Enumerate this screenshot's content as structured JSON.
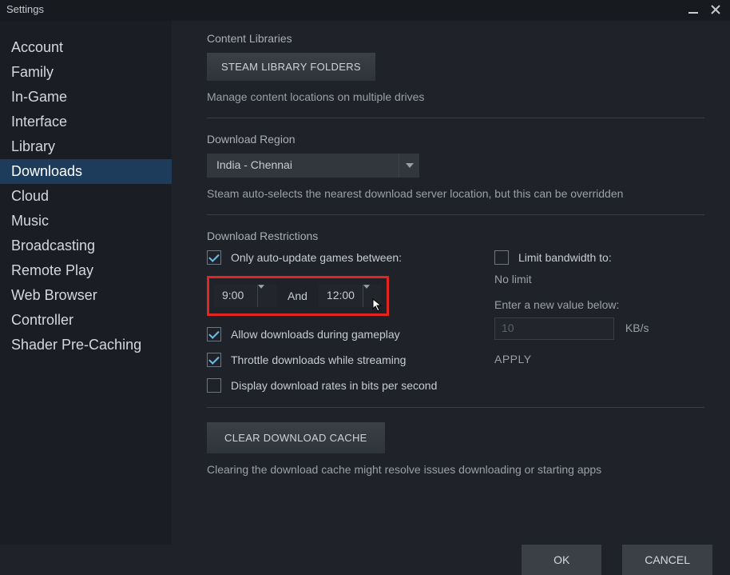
{
  "window": {
    "title": "Settings"
  },
  "sidebar": {
    "items": [
      {
        "label": "Account"
      },
      {
        "label": "Family"
      },
      {
        "label": "In-Game"
      },
      {
        "label": "Interface"
      },
      {
        "label": "Library"
      },
      {
        "label": "Downloads"
      },
      {
        "label": "Cloud"
      },
      {
        "label": "Music"
      },
      {
        "label": "Broadcasting"
      },
      {
        "label": "Remote Play"
      },
      {
        "label": "Web Browser"
      },
      {
        "label": "Controller"
      },
      {
        "label": "Shader Pre-Caching"
      }
    ],
    "active_index": 5
  },
  "content_libraries": {
    "title": "Content Libraries",
    "button": "STEAM LIBRARY FOLDERS",
    "desc": "Manage content locations on multiple drives"
  },
  "download_region": {
    "title": "Download Region",
    "selected": "India - Chennai",
    "desc": "Steam auto-selects the nearest download server location, but this can be overridden"
  },
  "download_restrictions": {
    "title": "Download Restrictions",
    "auto_update_label": "Only auto-update games between:",
    "time_from": "9:00",
    "and_label": "And",
    "time_to": "12:00",
    "allow_gameplay": "Allow downloads during gameplay",
    "throttle_streaming": "Throttle downloads while streaming",
    "bits_per_second": "Display download rates in bits per second",
    "limit_bandwidth_label": "Limit bandwidth to:",
    "no_limit": "No limit",
    "enter_value_label": "Enter a new value below:",
    "bandwidth_placeholder": "10",
    "bandwidth_unit": "KB/s",
    "apply": "APPLY"
  },
  "cache": {
    "button": "CLEAR DOWNLOAD CACHE",
    "desc": "Clearing the download cache might resolve issues downloading or starting apps"
  },
  "footer": {
    "ok": "OK",
    "cancel": "CANCEL"
  }
}
